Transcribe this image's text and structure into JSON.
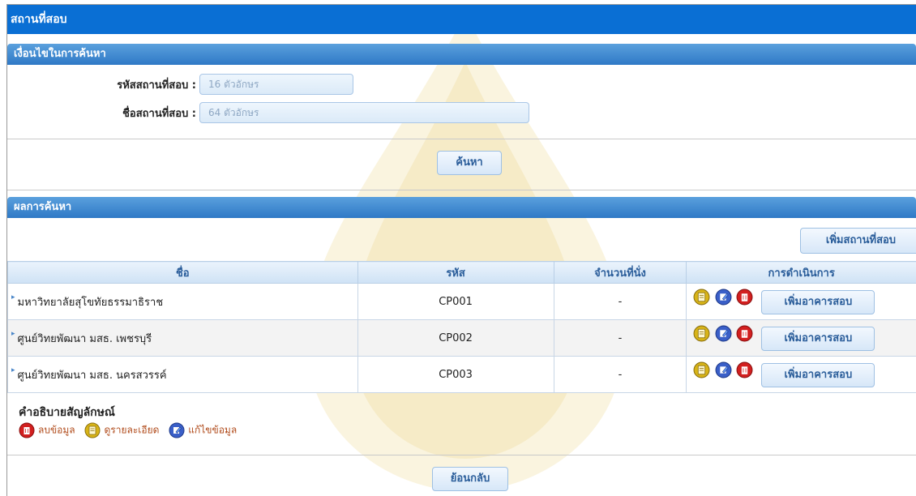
{
  "page": {
    "title": "สถานที่สอบ"
  },
  "search": {
    "section_title": "เงื่อนไขในการค้นหา",
    "code_label": "รหัสสถานที่สอบ :",
    "code_placeholder": "16 ตัวอักษร",
    "name_label": "ชื่อสถานที่สอบ :",
    "name_placeholder": "64 ตัวอักษร",
    "search_button": "ค้นหา"
  },
  "results": {
    "section_title": "ผลการค้นหา",
    "add_place_button": "เพิ่มสถานที่สอบ",
    "columns": [
      "ชื่อ",
      "รหัส",
      "จำนวนที่นั่ง",
      "การดำเนินการ"
    ],
    "rows": [
      {
        "name": "มหาวิทยาลัยสุโขทัยธรรมาธิราช",
        "code": "CP001",
        "seats": "-",
        "action_button": "เพิ่มอาคารสอบ"
      },
      {
        "name": "ศูนย์วิทยพัฒนา มสธ. เพชรบุรี",
        "code": "CP002",
        "seats": "-",
        "action_button": "เพิ่มอาคารสอบ"
      },
      {
        "name": "ศูนย์วิทยพัฒนา มสธ. นครสวรรค์",
        "code": "CP003",
        "seats": "-",
        "action_button": "เพิ่มอาคารสอบ"
      }
    ]
  },
  "legend": {
    "title": "คำอธิบายสัญลักษณ์",
    "delete_label": "ลบข้อมูล",
    "view_label": "ดูรายละเอียด",
    "edit_label": "แก้ไขข้อมูล"
  },
  "back_button": "ย้อนกลับ",
  "colors": {
    "title_bar": "#0a6fd4",
    "section_bar": "#3a86cf",
    "button_text": "#2a5d9a",
    "legend_text": "#b04a1a",
    "icon_view": "#d8b418",
    "icon_edit": "#3a5fc8",
    "icon_delete": "#d21f1f"
  },
  "icons": [
    "view-detail-icon",
    "edit-icon",
    "delete-icon",
    "row-arrow-icon"
  ]
}
